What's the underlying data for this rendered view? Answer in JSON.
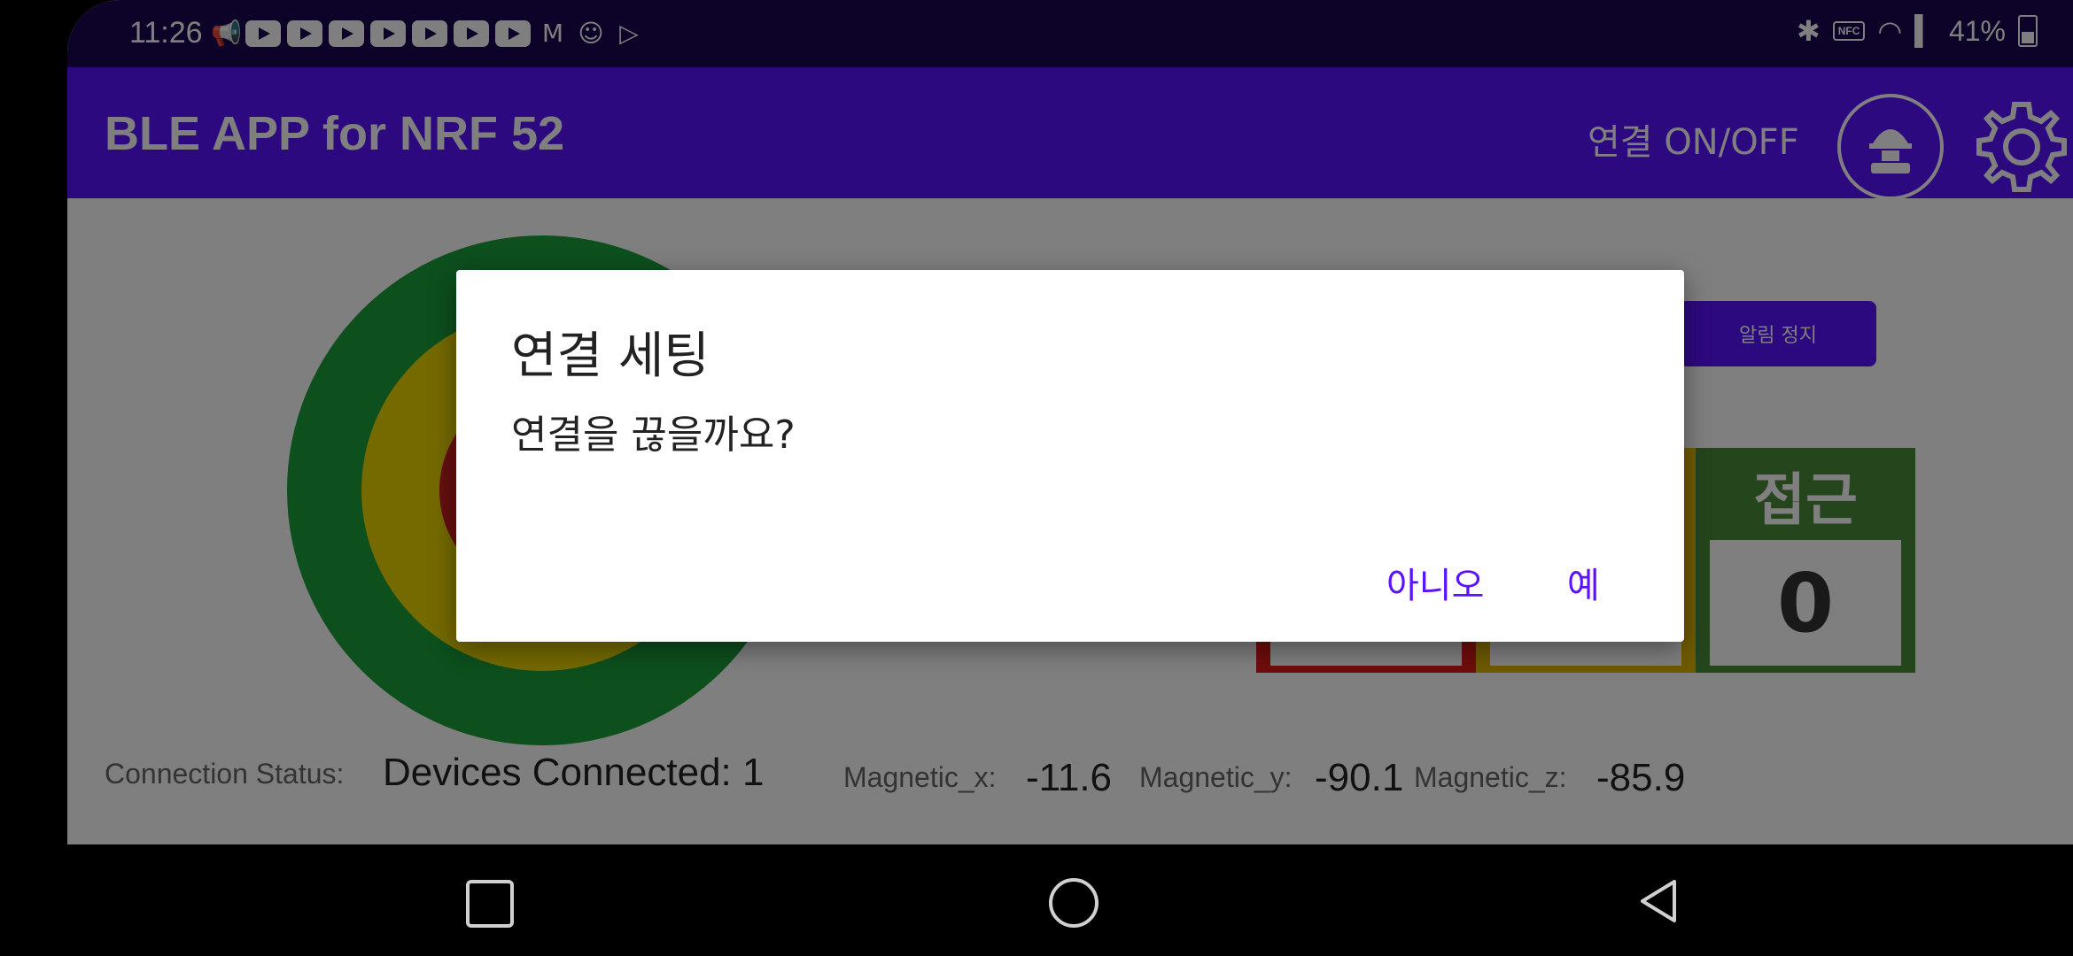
{
  "status_bar": {
    "time": "11:26",
    "battery": "41%",
    "notification_icons": [
      "megaphone-icon",
      "youtube-icon",
      "youtube-icon",
      "youtube-icon",
      "youtube-icon",
      "youtube-icon",
      "youtube-icon",
      "youtube-icon",
      "gmail-icon",
      "android-icon",
      "play-store-icon"
    ],
    "right_icons": [
      "bluetooth-icon",
      "nfc-icon",
      "wifi-icon",
      "signal-icon",
      "battery-icon"
    ],
    "nfc_label": "NFC"
  },
  "app_bar": {
    "title": "BLE APP for NRF 52",
    "connect_toggle": "연결 ON/OFF",
    "icons": [
      "helmet-worker-icon",
      "gear-icon"
    ]
  },
  "main": {
    "alarm_stop": "알림 정지",
    "target_rings": {
      "outer": "#1a9e3a",
      "middle": "#e8d400",
      "inner": "#cc1e1e"
    },
    "cards": [
      {
        "color": "#e01b1b",
        "label": "",
        "value": ""
      },
      {
        "color": "#e0b400",
        "label": "",
        "value": ""
      },
      {
        "color": "#4a8a3a",
        "label": "접근",
        "value": "0"
      }
    ],
    "connection_status_label": "Connection Status:",
    "connection_status_value": "Devices Connected: 1",
    "mag_x_label": "Magnetic_x:",
    "mag_x_value": "-11.6",
    "mag_y_label": "Magnetic_y:",
    "mag_y_value": "-90.1",
    "mag_z_label": "Magnetic_z:",
    "mag_z_value": "-85.9"
  },
  "dialog": {
    "title": "연결 세팅",
    "message": "연결을 끊을까요?",
    "negative": "아니오",
    "positive": "예"
  },
  "nav_bar": {
    "icons": [
      "recents-icon",
      "home-icon",
      "back-icon"
    ]
  },
  "colors": {
    "accent": "#5b13ff",
    "status_bar": "#1a0450"
  }
}
